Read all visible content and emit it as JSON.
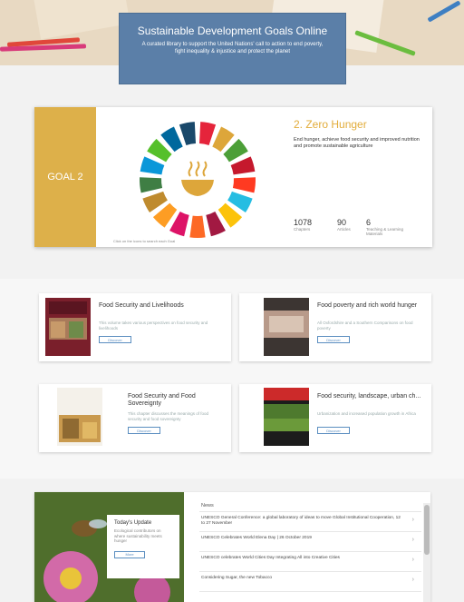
{
  "header": {
    "title": "Sustainable Development Goals Online",
    "subtitle": "A curated library to support the United Nations' call to action to end poverty, fight inequality & injustice and protect the planet"
  },
  "goal": {
    "side_label": "GOAL 2",
    "title": "2. Zero Hunger",
    "description": "End hunger, achieve food security and improved nutrition and promote sustainable agriculture",
    "wheel_caption": "Click on the icons to search each Goal",
    "stats": [
      {
        "value": "1078",
        "label": "Chapters"
      },
      {
        "value": "90",
        "label": "Articles"
      },
      {
        "value": "6",
        "label": "Teaching & Learning Materials"
      }
    ],
    "wheel_colors": [
      "#e5243b",
      "#dda63a",
      "#4c9f38",
      "#c5192d",
      "#ff3a21",
      "#26bde2",
      "#fcc30b",
      "#a21942",
      "#fd6925",
      "#dd1367",
      "#fd9d24",
      "#bf8b2e",
      "#3f7e44",
      "#0a97d9",
      "#56c02b",
      "#00689d",
      "#19486a"
    ]
  },
  "resources": [
    {
      "title": "Food Security and Livelihoods",
      "sub": "This volume takes various perspectives on food security and livelihoods",
      "button": "Discover"
    },
    {
      "title": "Food poverty and rich world hunger",
      "sub": "All Oxfordshire and a Southern Comparisons on food poverty",
      "button": "Discover"
    },
    {
      "title": "Food Security and Food Sovereignty",
      "sub": "This chapter discusses the meanings of food security and food sovereignty",
      "button": "Discover"
    },
    {
      "title": "Food security, landscape, urban ch...",
      "sub": "Urbanization and increased population growth in Africa",
      "button": "Discover"
    }
  ],
  "featured": {
    "title": "Today's Update",
    "description": "Ecological contributors on where sustainability meets hunger",
    "button": "More"
  },
  "news": {
    "heading": "News",
    "items": [
      "UNESCO General Conference: a global laboratory of ideas to move Global Institutional Cooperation, 12 to 27 November",
      "UNESCO Celebrates World Elena Day | 26 October 2019",
      "UNESCO celebrates World Cities Day Integrating All into Creative Cities",
      "Considering Sugar, the new Tobacco"
    ]
  }
}
